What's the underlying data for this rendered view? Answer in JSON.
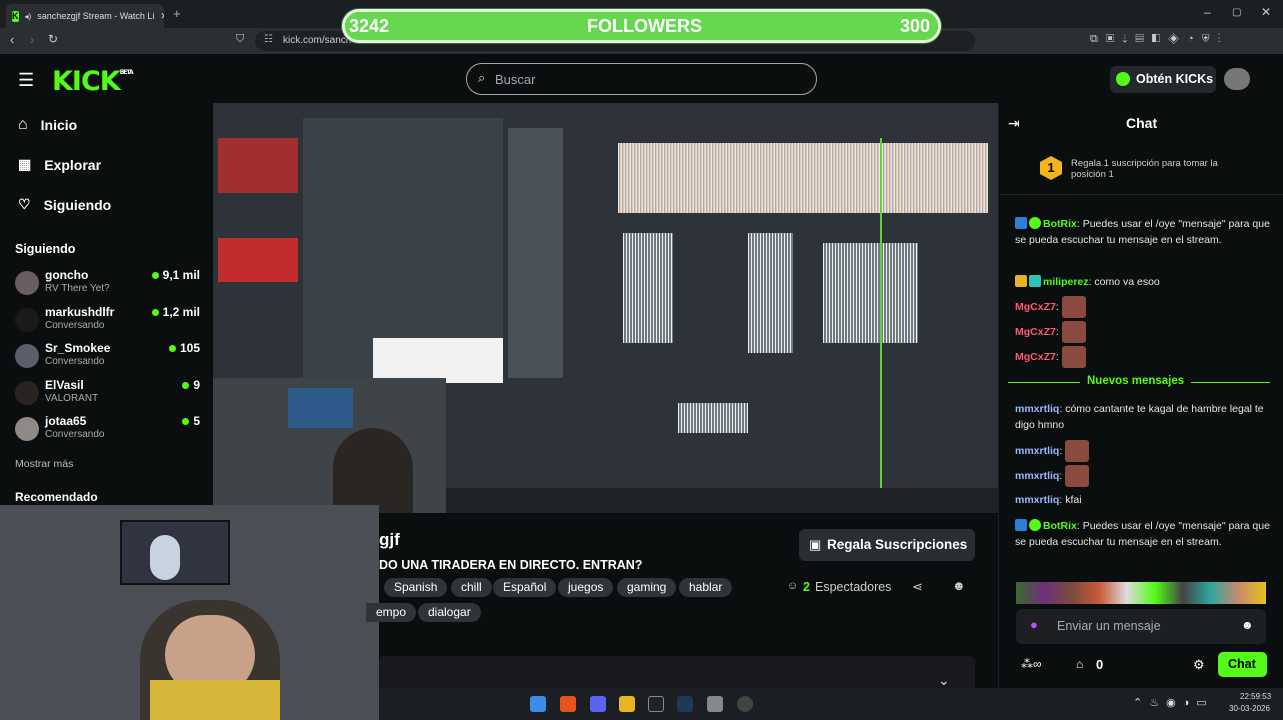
{
  "browser": {
    "tab_title": "sanchezgjf Stream - Watch Li",
    "url": "kick.com/sanch",
    "favicon": "K"
  },
  "overlay": {
    "followers_current": "3242",
    "followers_label": "FOLLOWERS",
    "followers_goal": "300"
  },
  "header": {
    "logo": "KICK",
    "logo_sup": "BETA",
    "search_placeholder": "Buscar",
    "get_kicks": "Obtén KICKs"
  },
  "sidebar": {
    "nav": [
      {
        "label": "Inicio"
      },
      {
        "label": "Explorar"
      },
      {
        "label": "Siguiendo"
      }
    ],
    "following_title": "Siguiendo",
    "channels": [
      {
        "name": "goncho",
        "sub": "RV There Yet?",
        "viewers": "9,1 mil"
      },
      {
        "name": "markushdlfr",
        "sub": "Conversando",
        "viewers": "1,2 mil"
      },
      {
        "name": "Sr_Smokee",
        "sub": "Conversando",
        "viewers": "105"
      },
      {
        "name": "ElVasil",
        "sub": "VALORANT",
        "viewers": "9"
      },
      {
        "name": "jotaa65",
        "sub": "Conversando",
        "viewers": "5"
      }
    ],
    "show_more": "Mostrar más",
    "recommended": "Recomendado"
  },
  "stream": {
    "streamer_partial": "gjf",
    "title_partial": "DO UNA TIRADERA EN DIRECTO. ENTRAN?",
    "tags": [
      "Spanish",
      "chill",
      "Español",
      "juegos",
      "gaming",
      "hablar"
    ],
    "tags_row2": [
      "empo",
      "dialogar"
    ],
    "gift_button": "Regala Suscripciones",
    "viewers": "2",
    "viewers_label": "Espectadores"
  },
  "chat": {
    "title": "Chat",
    "pinned": "Regala 1 suscripción para tomar la posición 1",
    "pinned_rank": "1",
    "messages": [
      {
        "user": "BotRix",
        "text": "Puedes usar el /oye \"mensaje\" para que se pueda escuchar tu mensaje en el stream.",
        "color": "#53fc18"
      },
      {
        "user": "miliperez",
        "text": "como va esoo",
        "color": "#53fc18"
      },
      {
        "user": "MgCxZ7",
        "text": "",
        "color": "#ff5a6e"
      },
      {
        "user": "MgCxZ7",
        "text": "",
        "color": "#ff5a6e"
      },
      {
        "user": "MgCxZ7",
        "text": "",
        "color": "#ff5a6e"
      }
    ],
    "new_messages": "Nuevos mensajes",
    "messages2": [
      {
        "user": "mmxrtliq",
        "text": "cómo cantante te kagal de hambre legal te digo hmno",
        "color": "#9ab7ff"
      },
      {
        "user": "mmxrtliq",
        "text": "",
        "color": "#9ab7ff"
      },
      {
        "user": "mmxrtliq",
        "text": "",
        "color": "#9ab7ff"
      },
      {
        "user": "mmxrtliq",
        "text": "kfai",
        "color": "#9ab7ff"
      },
      {
        "user": "BotRix",
        "text": "Puedes usar el /oye \"mensaje\" para que se pueda escuchar tu mensaje en el stream.",
        "color": "#53fc18"
      }
    ],
    "input_placeholder": "Enviar un mensaje",
    "points": "0",
    "send_button": "Chat"
  },
  "taskbar": {
    "time": "22:59:53",
    "date": "30-03-2026"
  }
}
